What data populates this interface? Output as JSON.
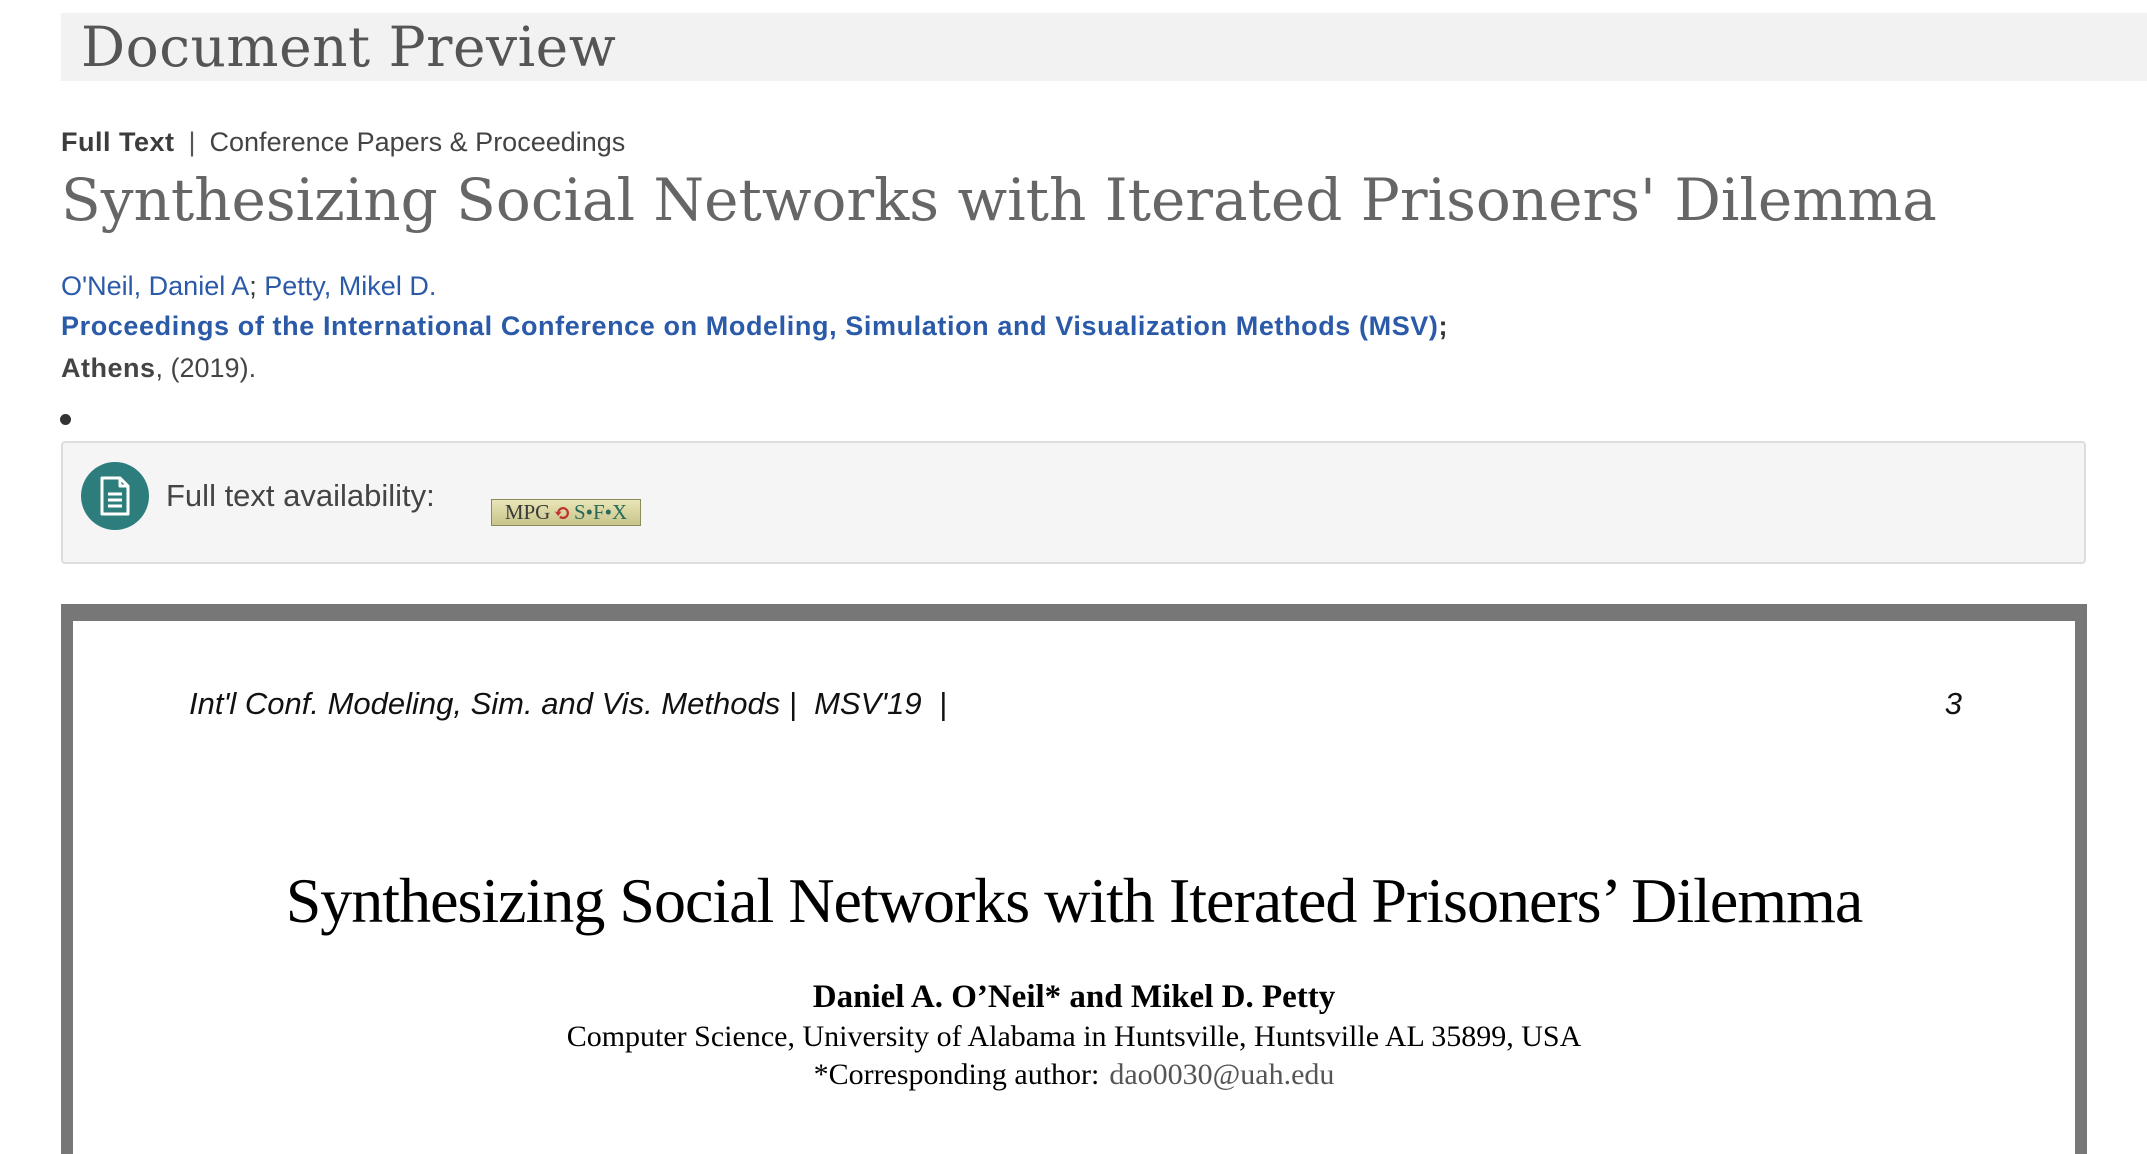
{
  "header": {
    "title": "Document Preview"
  },
  "record": {
    "type": "Full Text",
    "separator": "|",
    "category": "Conference Papers & Proceedings",
    "title": "Synthesizing Social Networks with Iterated Prisoners' Dilemma",
    "authors": [
      {
        "name": "O'Neil, Daniel A"
      },
      {
        "name": "Petty, Mikel D."
      }
    ],
    "author_separator": ";",
    "source": "Proceedings of the International Conference on Modeling, Simulation and Visualization Methods (MSV)",
    "source_terminator": ";",
    "place": "Athens",
    "year": ", (2019)."
  },
  "availability": {
    "label": "Full text availability:",
    "link_mpg": "MPG",
    "link_swirl": "⟲",
    "link_sfx": "S•F•X",
    "icon": "document-icon"
  },
  "document": {
    "running_head": "Int'l Conf. Modeling, Sim. and Vis. Methods |  MSV'19  |",
    "page_number": "3",
    "title": "Synthesizing Social Networks with Iterated Prisoners’ Dilemma",
    "authors": "Daniel A. O’Neil* and Mikel D. Petty",
    "affiliation": "Computer Science, University of Alabama in Huntsville, Huntsville AL 35899, USA",
    "corresponding_label": "*Corresponding author:",
    "corresponding_email": "dao0030@uah.edu"
  },
  "colors": {
    "link": "#2a5aa8",
    "icon_bg": "#2e7d7d",
    "viewer_frame": "#777777"
  }
}
